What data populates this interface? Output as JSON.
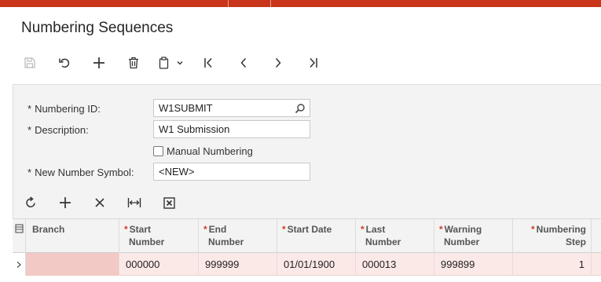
{
  "page": {
    "title": "Numbering Sequences"
  },
  "toolbar": {
    "buttons": [
      {
        "name": "save-button",
        "icon": "save-icon",
        "enabled": false
      },
      {
        "name": "undo-button",
        "icon": "undo-icon",
        "enabled": true
      },
      {
        "name": "add-button",
        "icon": "plus-icon",
        "enabled": true
      },
      {
        "name": "delete-button",
        "icon": "trash-icon",
        "enabled": true
      },
      {
        "name": "copy-paste-button",
        "icon": "clipboard-icon",
        "enabled": true
      },
      {
        "name": "first-record-button",
        "icon": "first-icon",
        "enabled": true
      },
      {
        "name": "previous-record-button",
        "icon": "chevron-left-icon",
        "enabled": true
      },
      {
        "name": "next-record-button",
        "icon": "chevron-right-icon",
        "enabled": true
      },
      {
        "name": "last-record-button",
        "icon": "last-icon",
        "enabled": true
      }
    ]
  },
  "form": {
    "numbering_id": {
      "label": "Numbering ID:",
      "value": "W1SUBMIT",
      "required": "*"
    },
    "description": {
      "label": "Description:",
      "value": "W1 Submission",
      "required": "*"
    },
    "manual_numbering": {
      "label": "Manual Numbering",
      "checked": false
    },
    "new_number_symbol": {
      "label": "New Number Symbol:",
      "value": "<NEW>",
      "required": "*"
    }
  },
  "grid_toolbar": {
    "buttons": [
      {
        "name": "refresh-button",
        "icon": "refresh-icon"
      },
      {
        "name": "add-row-button",
        "icon": "plus-icon"
      },
      {
        "name": "delete-row-button",
        "icon": "close-icon"
      },
      {
        "name": "fit-columns-button",
        "icon": "fit-width-icon"
      },
      {
        "name": "export-excel-button",
        "icon": "excel-icon"
      }
    ]
  },
  "grid": {
    "columns": [
      {
        "key": "branch",
        "label_line1": "Branch",
        "label_line2": "",
        "required": ""
      },
      {
        "key": "start_number",
        "label_line1": "Start",
        "label_line2": "Number",
        "required": "*"
      },
      {
        "key": "end_number",
        "label_line1": "End",
        "label_line2": "Number",
        "required": "*"
      },
      {
        "key": "start_date",
        "label_line1": "Start Date",
        "label_line2": "",
        "required": "*"
      },
      {
        "key": "last_number",
        "label_line1": "Last",
        "label_line2": "Number",
        "required": "*"
      },
      {
        "key": "warning_number",
        "label_line1": "Warning",
        "label_line2": "Number",
        "required": "*"
      },
      {
        "key": "numbering_step",
        "label_line1": "Numbering",
        "label_line2": "Step",
        "required": "*"
      }
    ],
    "rows": [
      {
        "branch": "",
        "start_number": "000000",
        "end_number": "999999",
        "start_date": "01/01/1900",
        "last_number": "000013",
        "warning_number": "999899",
        "numbering_step": "1"
      }
    ]
  },
  "colors": {
    "accent": "#c8351a",
    "required_marker": "#d33c2a",
    "selected_row": "#fbe9e7",
    "error_cell": "#f2c9c4"
  }
}
